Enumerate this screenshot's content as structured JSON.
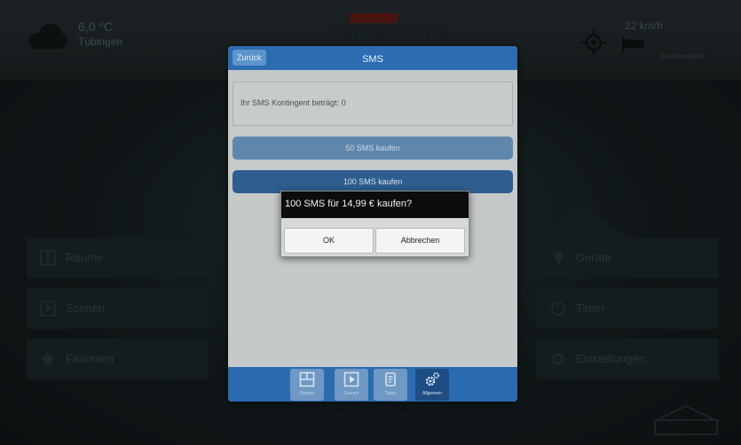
{
  "header": {
    "weather": {
      "temperature": "6,0 °C",
      "city": "Tübingen",
      "icon": "cloud-icon"
    },
    "brand": "brennenstuhl®",
    "wind": {
      "speed": "22 km/h",
      "direction": "Nordnordwest"
    }
  },
  "tiles": {
    "left": [
      {
        "label": "Räume",
        "icon": "rooms-icon"
      },
      {
        "label": "Szenen",
        "icon": "scenes-icon"
      },
      {
        "label": "Favoriten",
        "icon": "star-icon"
      }
    ],
    "right": [
      {
        "label": "Geräte",
        "icon": "device-icon"
      },
      {
        "label": "Timer",
        "icon": "timer-icon"
      },
      {
        "label": "Einstellungen",
        "icon": "gear-icon"
      }
    ]
  },
  "modal": {
    "back_label": "Zurück",
    "title": "SMS",
    "quota_text": "Ihr SMS Kontingent beträgt: 0",
    "buy_50_label": "50 SMS kaufen",
    "buy_100_label": "100 SMS kaufen",
    "nav": [
      {
        "label": "Räume",
        "icon": "rooms-icon"
      },
      {
        "label": "Szenen",
        "icon": "scenes-icon"
      },
      {
        "label": "Tasks",
        "icon": "tasks-icon"
      },
      {
        "label": "Allgemein",
        "icon": "gears-icon",
        "active": true
      }
    ]
  },
  "dialog": {
    "message": "100 SMS für 14,99 € kaufen?",
    "ok_label": "OK",
    "cancel_label": "Abbrechen"
  },
  "colors": {
    "accent": "#2d6cb0",
    "modal_bg": "#c5c9ca",
    "dialog_title_bg": "#0c0c0c"
  }
}
